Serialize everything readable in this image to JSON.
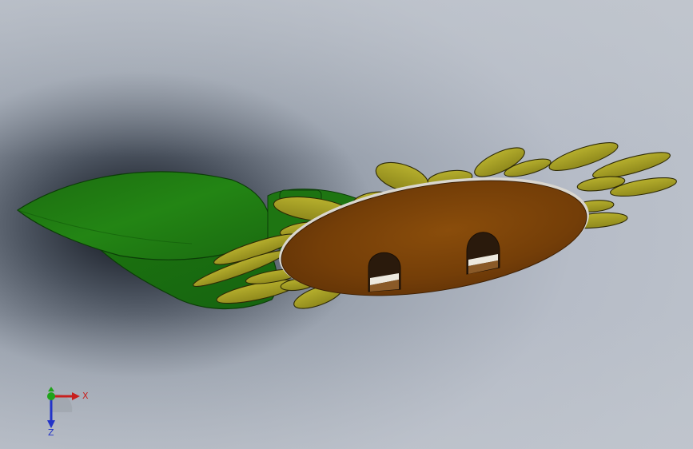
{
  "viewport": {
    "background_colors": [
      "#0b0f17",
      "#7b8595",
      "#b4bbc7",
      "#bcc2cb"
    ],
    "model": {
      "name": "sunflower",
      "parts": [
        {
          "part": "leaf",
          "color": "#1f7a12",
          "edge": "#0c3d08"
        },
        {
          "part": "stem",
          "color": "#1e7512"
        },
        {
          "part": "petal",
          "color": "#a9a326",
          "edge": "#2e2a06"
        },
        {
          "part": "center-disc",
          "color": "#7a4209",
          "rim": "#d9d6cf"
        },
        {
          "part": "hole",
          "color": "#2a1a0c"
        }
      ]
    }
  },
  "triad": {
    "x_label": "X",
    "z_label": "Z",
    "x_color": "#c8201e",
    "y_color": "#1fa31a",
    "z_color": "#2233c8"
  }
}
